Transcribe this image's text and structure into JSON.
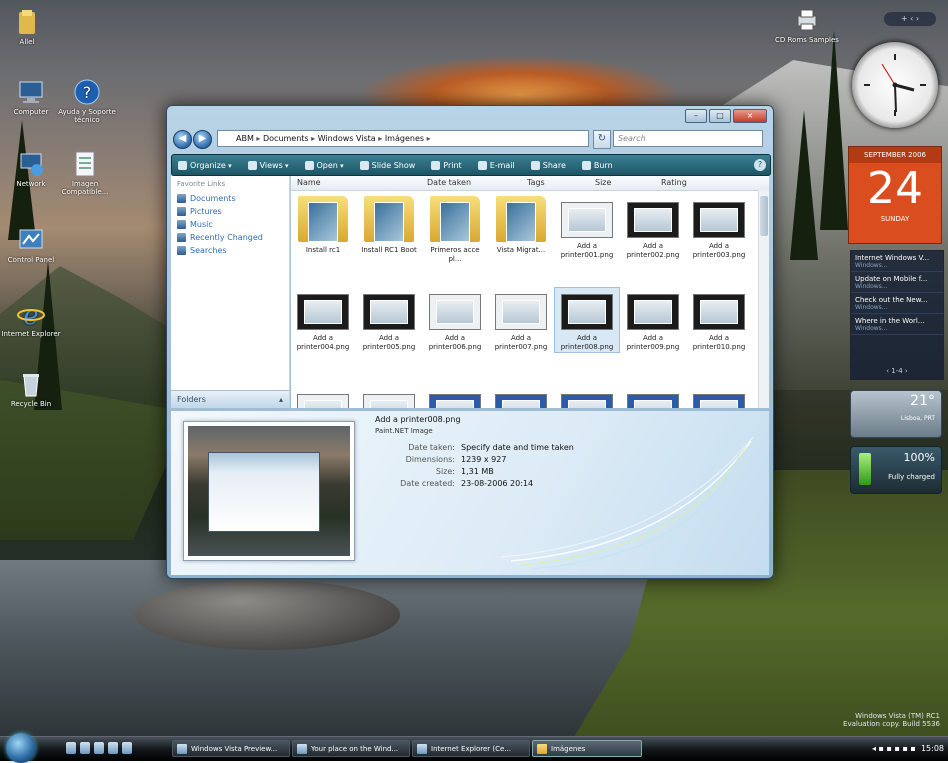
{
  "desktop": {
    "icons": [
      {
        "label": "Allel",
        "glyph": "user-folder-icon"
      },
      {
        "label": "Computer",
        "glyph": "computer-icon"
      },
      {
        "label": "Ayuda y Soporte técnico",
        "glyph": "help-icon"
      },
      {
        "label": "Network",
        "glyph": "network-icon"
      },
      {
        "label": "Imagen Compatible...",
        "glyph": "document-icon"
      },
      {
        "label": "Control Panel",
        "glyph": "control-panel-icon"
      },
      {
        "label": "Internet Explorer",
        "glyph": "internet-explorer-icon"
      },
      {
        "label": "Recycle Bin",
        "glyph": "recycle-bin-icon"
      },
      {
        "label": "CD Roms Samples",
        "glyph": "printer-icon"
      }
    ],
    "watermark": {
      "line1": "Windows Vista (TM) RC1",
      "line2": "Evaluation copy. Build 5536"
    }
  },
  "window": {
    "address": {
      "crumbs": [
        "ABM",
        "Documents",
        "Windows Vista",
        "Imágenes"
      ]
    },
    "search_placeholder": "Search",
    "toolbar": [
      {
        "label": "Organize",
        "dropdown": true
      },
      {
        "label": "Views",
        "dropdown": true
      },
      {
        "label": "Open",
        "dropdown": true
      },
      {
        "label": "Slide Show",
        "dropdown": false
      },
      {
        "label": "Print",
        "dropdown": false
      },
      {
        "label": "E-mail",
        "dropdown": false
      },
      {
        "label": "Share",
        "dropdown": false
      },
      {
        "label": "Burn",
        "dropdown": false
      }
    ],
    "nav": {
      "header": "Favorite Links",
      "links": [
        "Documents",
        "Pictures",
        "Music",
        "Recently Changed",
        "Searches"
      ],
      "folders_label": "Folders"
    },
    "columns": [
      "Name",
      "Date taken",
      "Tags",
      "Size",
      "Rating"
    ],
    "items": [
      {
        "label": "Install rc1",
        "kind": "folder"
      },
      {
        "label": "Install RC1 Boot",
        "kind": "folder"
      },
      {
        "label": "Primeros acce pl...",
        "kind": "folder"
      },
      {
        "label": "Vista Migrat...",
        "kind": "folder"
      },
      {
        "label": "Add a printer001.png",
        "kind": "shot-light"
      },
      {
        "label": "Add a printer002.png",
        "kind": "shot"
      },
      {
        "label": "Add a printer003.png",
        "kind": "shot"
      },
      {
        "label": "Add a printer004.png",
        "kind": "shot"
      },
      {
        "label": "Add a printer005.png",
        "kind": "shot"
      },
      {
        "label": "Add a printer006.png",
        "kind": "shot-light"
      },
      {
        "label": "Add a printer007.png",
        "kind": "shot-light"
      },
      {
        "label": "Add a printer008.png",
        "kind": "shot-selected"
      },
      {
        "label": "Add a printer009.png",
        "kind": "shot"
      },
      {
        "label": "Add a printer010.png",
        "kind": "shot"
      }
    ],
    "details": {
      "filename": "Add a printer008.png",
      "filetype": "Paint.NET Image",
      "fields": [
        {
          "key": "Date taken:",
          "value": "Specify date and time taken"
        },
        {
          "key": "Dimensions:",
          "value": "1239 x 927"
        },
        {
          "key": "Size:",
          "value": "1,31 MB"
        },
        {
          "key": "Date created:",
          "value": "23-08-2006 20:14"
        }
      ]
    }
  },
  "sidebar": {
    "top_label": "+ ‹ ›",
    "calendar": {
      "month": "SEPTEMBER 2006",
      "day": "24",
      "weekday": "SUNDAY"
    },
    "feeds": [
      {
        "title": "Internet Windows V...",
        "sub": "Windows..."
      },
      {
        "title": "Update on Mobile f...",
        "sub": "Windows..."
      },
      {
        "title": "Check out the New...",
        "sub": "Windows..."
      },
      {
        "title": "Where in the Worl...",
        "sub": "Windows..."
      }
    ],
    "feeds_nav": "‹  1-4  ›",
    "weather": {
      "temp": "21°",
      "city": "Lisboa, PRT"
    },
    "battery": {
      "percent": "100%",
      "status": "Fully charged"
    }
  },
  "taskbar": {
    "buttons": [
      {
        "label": "Windows Vista Preview..."
      },
      {
        "label": "Your place on the Wind..."
      },
      {
        "label": "Internet Explorer (Ce..."
      },
      {
        "label": "Imágenes"
      }
    ],
    "clock": "15:08"
  },
  "colors": {
    "window_toolbar": "#2a6a7c",
    "calendar": "#d94d1f",
    "link": "#2e6db4"
  }
}
